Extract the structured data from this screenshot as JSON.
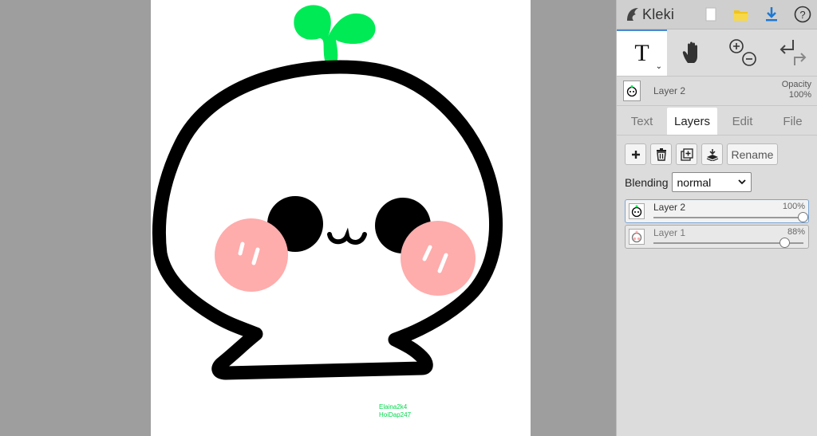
{
  "app": {
    "brand": "Kleki",
    "topbar_icons": [
      "new-image-icon",
      "open-folder-icon",
      "download-icon",
      "help-icon"
    ],
    "accent": "#4a8ad0"
  },
  "tools": {
    "text_tool_glyph": "T",
    "items": [
      "text-tool-icon",
      "hand-tool-icon",
      "zoom-in-icon",
      "zoom-out-icon",
      "undo-icon",
      "redo-icon"
    ]
  },
  "current_layer": {
    "name": "Layer 2",
    "opacity_label": "Opacity",
    "opacity_value": "100%"
  },
  "tabs": [
    "Text",
    "Layers",
    "Edit",
    "File"
  ],
  "active_tab": "Layers",
  "layer_actions": {
    "add_icon": "plus-icon",
    "delete_icon": "trash-icon",
    "duplicate_icon": "duplicate-icon",
    "merge_icon": "merge-down-icon",
    "rename_label": "Rename"
  },
  "blending": {
    "label": "Blending",
    "value": "normal"
  },
  "layers": [
    {
      "name": "Layer 2",
      "opacity": "100%",
      "opacity_fraction": 1.0,
      "selected": true
    },
    {
      "name": "Layer 1",
      "opacity": "88%",
      "opacity_fraction": 0.88,
      "selected": false
    }
  ],
  "canvas": {
    "signature_line1": "Elaina2k4",
    "signature_line2": "HoiDap247",
    "colors": {
      "outline": "#000000",
      "sprout": "#00ea55",
      "cheeks": "#ffacac",
      "signature": "#00d84a"
    }
  }
}
